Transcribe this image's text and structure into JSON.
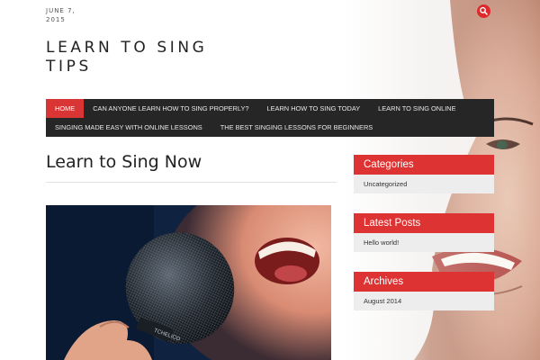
{
  "header": {
    "date": "JUNE 7, 2015",
    "site_title": "LEARN TO SING TIPS",
    "search_icon": "search-icon"
  },
  "nav": {
    "items": [
      {
        "label": "Home",
        "active": true
      },
      {
        "label": "Can anyone learn how to sing properly?"
      },
      {
        "label": "Learn how to sing today"
      },
      {
        "label": "Learn to sing online"
      },
      {
        "label": "Singing made easy with online lessons"
      },
      {
        "label": "The best singing lessons for beginners"
      }
    ]
  },
  "main": {
    "title": "Learn to Sing Now",
    "featured_image": "singer-with-microphone",
    "microphone_brand": "TCHELICO"
  },
  "sidebar": {
    "widgets": [
      {
        "title": "Categories",
        "items": [
          "Uncategorized"
        ]
      },
      {
        "title": "Latest Posts",
        "items": [
          "Hello world!"
        ]
      },
      {
        "title": "Archives",
        "items": [
          "August 2014"
        ]
      }
    ]
  },
  "colors": {
    "accent": "#dd3333",
    "nav_bg": "#262626",
    "widget_body_bg": "#ededed"
  }
}
